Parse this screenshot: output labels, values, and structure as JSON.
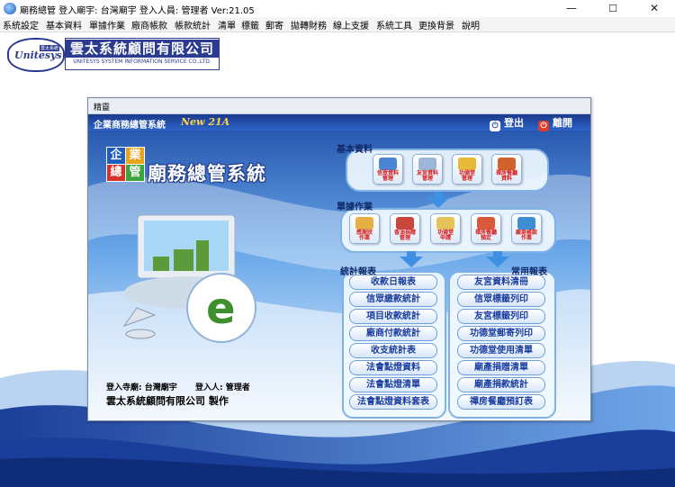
{
  "window": {
    "title": "廟務總管  登入廟宇: 台灣廟宇  登入人員: 管理者 Ver:21.05",
    "controls": {
      "minimize": "—",
      "maximize": "☐",
      "close": "✕"
    }
  },
  "menu": [
    "系統設定",
    "基本資料",
    "單據作業",
    "廠商帳款",
    "帳款統計",
    "清單",
    "標籤",
    "郵寄",
    "拋轉財務",
    "線上支援",
    "系統工具",
    "更換背景",
    "說明"
  ],
  "company_logo": {
    "mark": "Unitesys",
    "mark_badge": "雲太系統",
    "name_zh": "雲太系統顧問有限公司",
    "name_en": "UNITESYS SYSTEM INFORMATION SERVICE CO.,LTD."
  },
  "panel": {
    "caption": "精靈",
    "header_title": "企業商務總管系統",
    "header_version": "New 21A",
    "logout_label": "登出",
    "exit_label": "離開",
    "system_logo": {
      "cubes": [
        "企",
        "業",
        "總",
        "管"
      ],
      "name": "廟務總管系統"
    },
    "basic": {
      "label": "基本資料",
      "items": [
        {
          "line1": "信眾資料",
          "line2": "管理"
        },
        {
          "line1": "友宮資料",
          "line2": "管理"
        },
        {
          "line1": "功德堂",
          "line2": "管理"
        },
        {
          "line1": "禪房餐廳",
          "line2": "資料"
        }
      ]
    },
    "documents": {
      "label": "單據作業",
      "items": [
        {
          "line1": "感謝狀",
          "line2": "作業"
        },
        {
          "line1": "香油捐贈",
          "line2": "管理"
        },
        {
          "line1": "功德堂",
          "line2": "申請"
        },
        {
          "line1": "禪房餐廳",
          "line2": "預定"
        },
        {
          "line1": "廠商帳款",
          "line2": "作業"
        }
      ]
    },
    "stat_reports": {
      "label": "統計報表",
      "items": [
        "收款日報表",
        "信眾繳款統計",
        "項目收款統計",
        "廠商付款統計",
        "收支統計表",
        "法會點燈資料",
        "法會點燈清單",
        "法會點燈資料套表"
      ]
    },
    "common_reports": {
      "label": "常用報表",
      "items": [
        "友宮資料清冊",
        "信眾標籤列印",
        "友宮標籤列印",
        "功德堂郵寄列印",
        "功德堂使用清單",
        "廟產捐贈清單",
        "廟產捐款統計",
        "禪房餐廳預訂表"
      ]
    },
    "footer": {
      "temple_label": "登入寺廟:",
      "temple_value": "台灣廟宇",
      "user_label": "登入人:",
      "user_value": "管理者",
      "company_credit": "雲太系統顧問有限公司  製作"
    }
  },
  "colors": {
    "accent": "#2e63c8",
    "label_red": "#d61b1b",
    "report_text": "#1a3ea0"
  }
}
